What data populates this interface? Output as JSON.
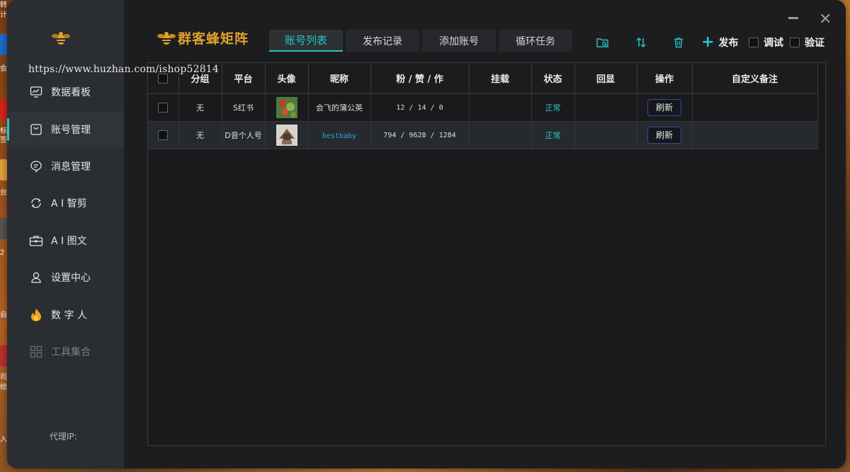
{
  "watermark": "https://www.huzhan.com/ishop52814",
  "desktop": {
    "items": [
      "转",
      "计",
      "会",
      "标",
      "签",
      "台",
      "2",
      "自",
      "司",
      "给",
      "入"
    ],
    "tile_colors": [
      "#1a6fd1",
      "#d9251c",
      "#e6a23c",
      "#555",
      "#c03030",
      "#2a2a2a"
    ]
  },
  "brand": {
    "name": "群客蜂矩阵",
    "color": "#e2a22a"
  },
  "accent_color": "#27c4c8",
  "sidebar": {
    "items": [
      {
        "label": "数据看板",
        "icon": "chart-icon"
      },
      {
        "label": "账号管理",
        "icon": "bag-icon",
        "active": true
      },
      {
        "label": "消息管理",
        "icon": "chat-icon"
      },
      {
        "label": "A I 智剪",
        "icon": "refresh-gear-icon"
      },
      {
        "label": "A I 图文",
        "icon": "briefcase-icon"
      },
      {
        "label": "设置中心",
        "icon": "user-settings-icon"
      },
      {
        "label": "数 字 人",
        "icon": "flame-icon"
      },
      {
        "label": "工具集合",
        "icon": "grid-icon",
        "disabled": true
      }
    ],
    "proxy_label": "代理IP:"
  },
  "tabs": [
    {
      "label": "账号列表",
      "active": true
    },
    {
      "label": "发布记录"
    },
    {
      "label": "添加账号"
    },
    {
      "label": "循环任务"
    }
  ],
  "toolbar": {
    "publish_label": "发布",
    "debug_label": "调试",
    "verify_label": "验证"
  },
  "table": {
    "headers": [
      "分组",
      "平台",
      "头像",
      "昵称",
      "粉 / 赞 / 作",
      "挂载",
      "状态",
      "回显",
      "操作",
      "自定义备注"
    ],
    "rows": [
      {
        "group": "无",
        "platform": "S红书",
        "nickname": "会飞的蒲公英",
        "stats": "12 / 14 / 0",
        "mount": "",
        "status": "正常",
        "echo": "",
        "action": "刷新",
        "note": ""
      },
      {
        "group": "无",
        "platform": "D音个人号",
        "nickname": "bestbaby",
        "stats": "794 / 9628 / 1284",
        "mount": "",
        "status": "正常",
        "echo": "",
        "action": "刷新",
        "note": ""
      }
    ]
  }
}
